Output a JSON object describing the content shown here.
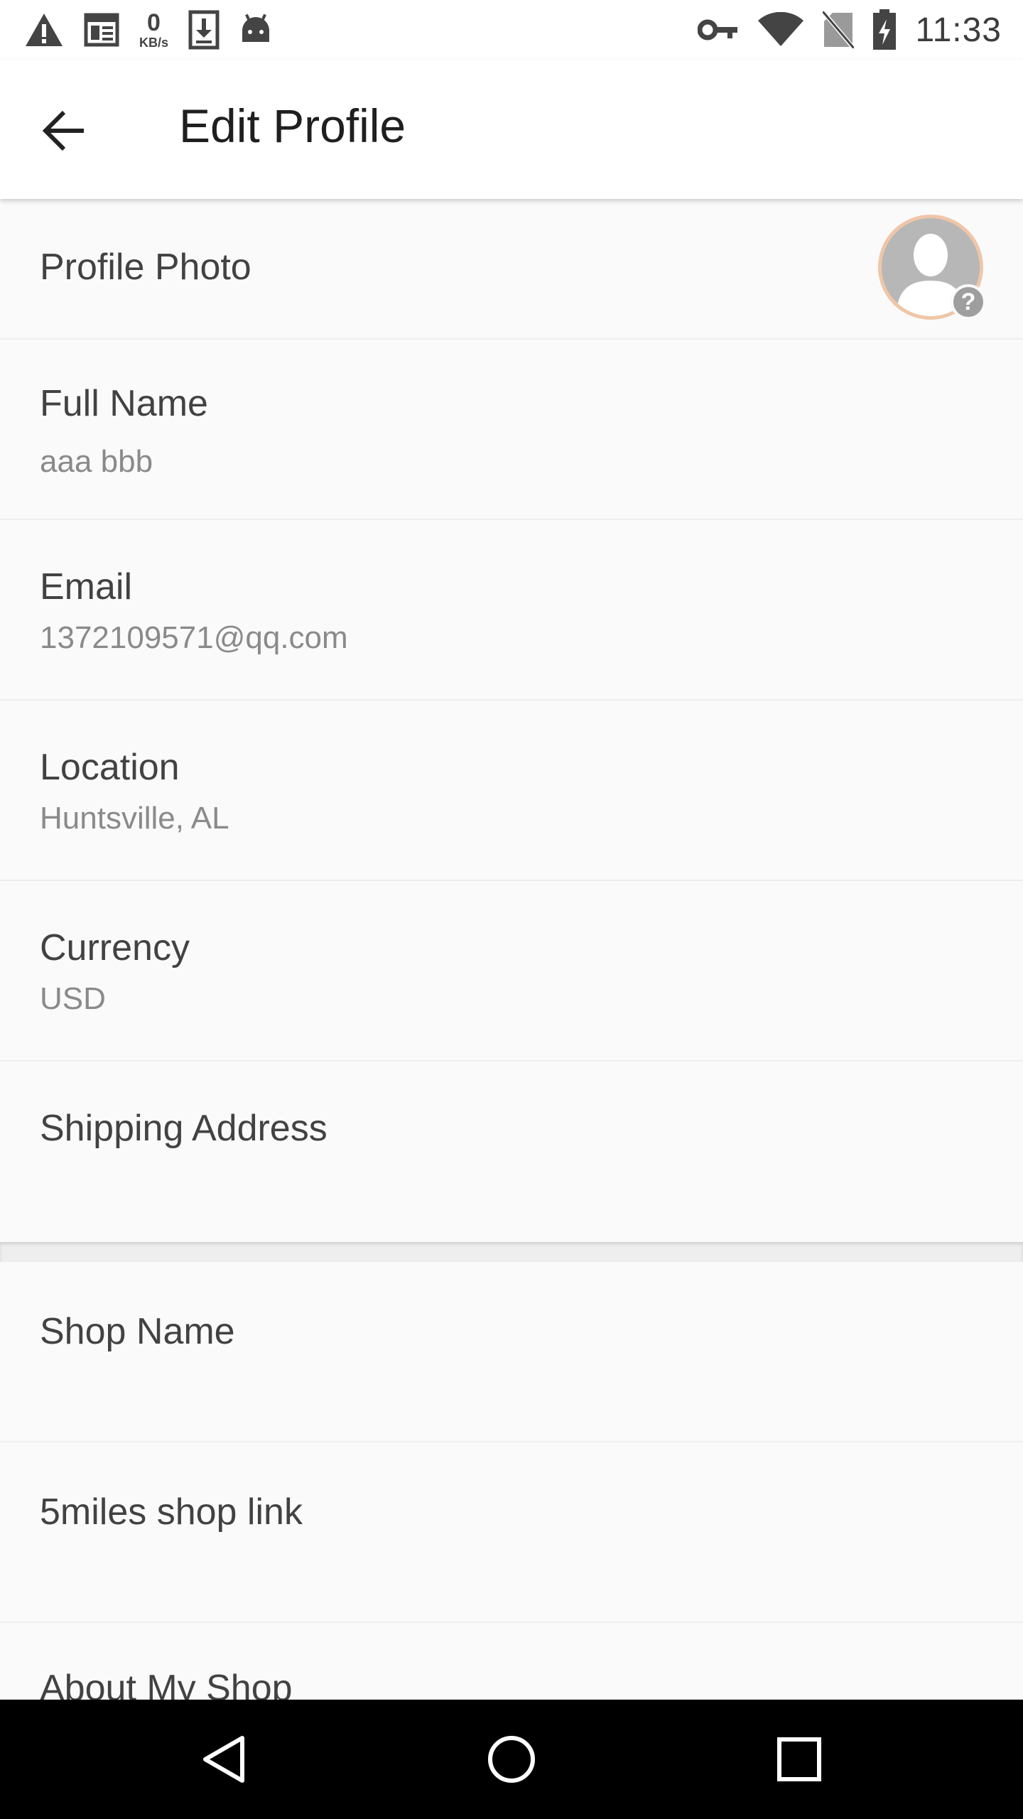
{
  "status_bar": {
    "speed_value": "0",
    "speed_unit": "KB/s",
    "time": "11:33",
    "icons": [
      "warning-icon",
      "news-icon",
      "download-icon",
      "android-icon",
      "vpn-key-icon",
      "wifi-icon",
      "no-sim-icon",
      "battery-charging-icon"
    ]
  },
  "app_bar": {
    "back_icon": "arrow-left-icon",
    "title": "Edit Profile"
  },
  "profile": {
    "photo_label": "Profile Photo",
    "badge_text": "?",
    "fields": [
      {
        "label": "Full Name",
        "value": "aaa bbb"
      },
      {
        "label": "Email",
        "value": "1372109571@qq.com"
      },
      {
        "label": "Location",
        "value": "Huntsville, AL"
      },
      {
        "label": "Currency",
        "value": "USD"
      },
      {
        "label": "Shipping Address",
        "value": ""
      }
    ]
  },
  "shop": {
    "fields": [
      {
        "label": "Shop Name",
        "value": ""
      },
      {
        "label": "5miles shop link",
        "value": ""
      },
      {
        "label": "About My Shop",
        "value": ""
      }
    ]
  },
  "nav_bar": {
    "icons": [
      "back-triangle-icon",
      "home-circle-icon",
      "recents-square-icon"
    ]
  },
  "colors": {
    "background": "#fafafa",
    "label": "#424242",
    "value": "#8a8a8a",
    "avatar_ring": "#f0c6a8",
    "nav_bar": "#000000"
  }
}
